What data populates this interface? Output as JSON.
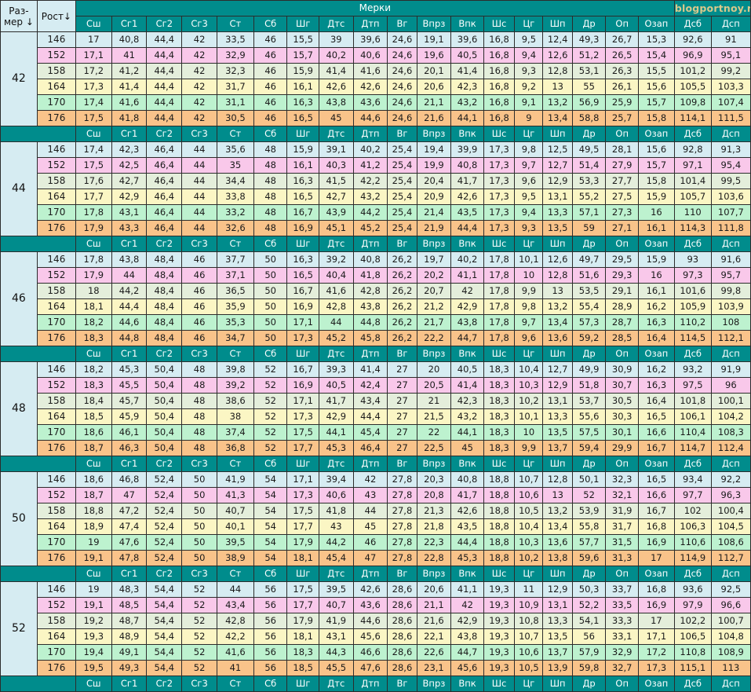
{
  "page": {
    "brand": "blogportnoy.ru",
    "group_header": "Мерки"
  },
  "headers": {
    "size_label_line1": "Раз-",
    "size_label_line2": "мер ↓",
    "growth_label": "Рост↓",
    "measures": [
      "Сш",
      "Сг1",
      "Сг2",
      "Сг3",
      "Ст",
      "Сб",
      "Шг",
      "Дтс",
      "Дтп",
      "Вг",
      "Впрз",
      "Впк",
      "Шс",
      "Цг",
      "Шп",
      "Др",
      "Оп",
      "Озап",
      "Дсб",
      "Дсп"
    ]
  },
  "blocks": [
    {
      "size": "42",
      "rows": [
        {
          "growth": "146",
          "values": [
            "17",
            "40,8",
            "44,4",
            "42",
            "33,5",
            "46",
            "15,5",
            "39",
            "39,6",
            "24,6",
            "19,1",
            "39,6",
            "16,8",
            "9,5",
            "12,4",
            "49,3",
            "26,7",
            "15,3",
            "92,6",
            "91"
          ]
        },
        {
          "growth": "152",
          "values": [
            "17,1",
            "41",
            "44,4",
            "42",
            "32,9",
            "46",
            "15,7",
            "40,2",
            "40,6",
            "24,6",
            "19,6",
            "40,5",
            "16,8",
            "9,4",
            "12,6",
            "51,2",
            "26,5",
            "15,4",
            "96,9",
            "95,1"
          ]
        },
        {
          "growth": "158",
          "values": [
            "17,2",
            "41,2",
            "44,4",
            "42",
            "32,3",
            "46",
            "15,9",
            "41,4",
            "41,6",
            "24,6",
            "20,1",
            "41,4",
            "16,8",
            "9,3",
            "12,8",
            "53,1",
            "26,3",
            "15,5",
            "101,2",
            "99,2"
          ]
        },
        {
          "growth": "164",
          "values": [
            "17,3",
            "41,4",
            "44,4",
            "42",
            "31,7",
            "46",
            "16,1",
            "42,6",
            "42,6",
            "24,6",
            "20,6",
            "42,3",
            "16,8",
            "9,2",
            "13",
            "55",
            "26,1",
            "15,6",
            "105,5",
            "103,3"
          ]
        },
        {
          "growth": "170",
          "values": [
            "17,4",
            "41,6",
            "44,4",
            "42",
            "31,1",
            "46",
            "16,3",
            "43,8",
            "43,6",
            "24,6",
            "21,1",
            "43,2",
            "16,8",
            "9,1",
            "13,2",
            "56,9",
            "25,9",
            "15,7",
            "109,8",
            "107,4"
          ]
        },
        {
          "growth": "176",
          "values": [
            "17,5",
            "41,8",
            "44,4",
            "42",
            "30,5",
            "46",
            "16,5",
            "45",
            "44,6",
            "24,6",
            "21,6",
            "44,1",
            "16,8",
            "9",
            "13,4",
            "58,8",
            "25,7",
            "15,8",
            "114,1",
            "111,5"
          ]
        }
      ]
    },
    {
      "size": "44",
      "rows": [
        {
          "growth": "146",
          "values": [
            "17,4",
            "42,3",
            "46,4",
            "44",
            "35,6",
            "48",
            "15,9",
            "39,1",
            "40,2",
            "25,4",
            "19,4",
            "39,9",
            "17,3",
            "9,8",
            "12,5",
            "49,5",
            "28,1",
            "15,6",
            "92,8",
            "91,3"
          ]
        },
        {
          "growth": "152",
          "values": [
            "17,5",
            "42,5",
            "46,4",
            "44",
            "35",
            "48",
            "16,1",
            "40,3",
            "41,2",
            "25,4",
            "19,9",
            "40,8",
            "17,3",
            "9,7",
            "12,7",
            "51,4",
            "27,9",
            "15,7",
            "97,1",
            "95,4"
          ]
        },
        {
          "growth": "158",
          "values": [
            "17,6",
            "42,7",
            "46,4",
            "44",
            "34,4",
            "48",
            "16,3",
            "41,5",
            "42,2",
            "25,4",
            "20,4",
            "41,7",
            "17,3",
            "9,6",
            "12,9",
            "53,3",
            "27,7",
            "15,8",
            "101,4",
            "99,5"
          ]
        },
        {
          "growth": "164",
          "values": [
            "17,7",
            "42,9",
            "46,4",
            "44",
            "33,8",
            "48",
            "16,5",
            "42,7",
            "43,2",
            "25,4",
            "20,9",
            "42,6",
            "17,3",
            "9,5",
            "13,1",
            "55,2",
            "27,5",
            "15,9",
            "105,7",
            "103,6"
          ]
        },
        {
          "growth": "170",
          "values": [
            "17,8",
            "43,1",
            "46,4",
            "44",
            "33,2",
            "48",
            "16,7",
            "43,9",
            "44,2",
            "25,4",
            "21,4",
            "43,5",
            "17,3",
            "9,4",
            "13,3",
            "57,1",
            "27,3",
            "16",
            "110",
            "107,7"
          ]
        },
        {
          "growth": "176",
          "values": [
            "17,9",
            "43,3",
            "46,4",
            "44",
            "32,6",
            "48",
            "16,9",
            "45,1",
            "45,2",
            "25,4",
            "21,9",
            "44,4",
            "17,3",
            "9,3",
            "13,5",
            "59",
            "27,1",
            "16,1",
            "114,3",
            "111,8"
          ]
        }
      ]
    },
    {
      "size": "46",
      "rows": [
        {
          "growth": "146",
          "values": [
            "17,8",
            "43,8",
            "48,4",
            "46",
            "37,7",
            "50",
            "16,3",
            "39,2",
            "40,8",
            "26,2",
            "19,7",
            "40,2",
            "17,8",
            "10,1",
            "12,6",
            "49,7",
            "29,5",
            "15,9",
            "93",
            "91,6"
          ]
        },
        {
          "growth": "152",
          "values": [
            "17,9",
            "44",
            "48,4",
            "46",
            "37,1",
            "50",
            "16,5",
            "40,4",
            "41,8",
            "26,2",
            "20,2",
            "41,1",
            "17,8",
            "10",
            "12,8",
            "51,6",
            "29,3",
            "16",
            "97,3",
            "95,7"
          ]
        },
        {
          "growth": "158",
          "values": [
            "18",
            "44,2",
            "48,4",
            "46",
            "36,5",
            "50",
            "16,7",
            "41,6",
            "42,8",
            "26,2",
            "20,7",
            "42",
            "17,8",
            "9,9",
            "13",
            "53,5",
            "29,1",
            "16,1",
            "101,6",
            "99,8"
          ]
        },
        {
          "growth": "164",
          "values": [
            "18,1",
            "44,4",
            "48,4",
            "46",
            "35,9",
            "50",
            "16,9",
            "42,8",
            "43,8",
            "26,2",
            "21,2",
            "42,9",
            "17,8",
            "9,8",
            "13,2",
            "55,4",
            "28,9",
            "16,2",
            "105,9",
            "103,9"
          ]
        },
        {
          "growth": "170",
          "values": [
            "18,2",
            "44,6",
            "48,4",
            "46",
            "35,3",
            "50",
            "17,1",
            "44",
            "44,8",
            "26,2",
            "21,7",
            "43,8",
            "17,8",
            "9,7",
            "13,4",
            "57,3",
            "28,7",
            "16,3",
            "110,2",
            "108"
          ]
        },
        {
          "growth": "176",
          "values": [
            "18,3",
            "44,8",
            "48,4",
            "46",
            "34,7",
            "50",
            "17,3",
            "45,2",
            "45,8",
            "26,2",
            "22,2",
            "44,7",
            "17,8",
            "9,6",
            "13,6",
            "59,2",
            "28,5",
            "16,4",
            "114,5",
            "112,1"
          ]
        }
      ]
    },
    {
      "size": "48",
      "rows": [
        {
          "growth": "146",
          "values": [
            "18,2",
            "45,3",
            "50,4",
            "48",
            "39,8",
            "52",
            "16,7",
            "39,3",
            "41,4",
            "27",
            "20",
            "40,5",
            "18,3",
            "10,4",
            "12,7",
            "49,9",
            "30,9",
            "16,2",
            "93,2",
            "91,9"
          ]
        },
        {
          "growth": "152",
          "values": [
            "18,3",
            "45,5",
            "50,4",
            "48",
            "39,2",
            "52",
            "16,9",
            "40,5",
            "42,4",
            "27",
            "20,5",
            "41,4",
            "18,3",
            "10,3",
            "12,9",
            "51,8",
            "30,7",
            "16,3",
            "97,5",
            "96"
          ]
        },
        {
          "growth": "158",
          "values": [
            "18,4",
            "45,7",
            "50,4",
            "48",
            "38,6",
            "52",
            "17,1",
            "41,7",
            "43,4",
            "27",
            "21",
            "42,3",
            "18,3",
            "10,2",
            "13,1",
            "53,7",
            "30,5",
            "16,4",
            "101,8",
            "100,1"
          ]
        },
        {
          "growth": "164",
          "values": [
            "18,5",
            "45,9",
            "50,4",
            "48",
            "38",
            "52",
            "17,3",
            "42,9",
            "44,4",
            "27",
            "21,5",
            "43,2",
            "18,3",
            "10,1",
            "13,3",
            "55,6",
            "30,3",
            "16,5",
            "106,1",
            "104,2"
          ]
        },
        {
          "growth": "170",
          "values": [
            "18,6",
            "46,1",
            "50,4",
            "48",
            "37,4",
            "52",
            "17,5",
            "44,1",
            "45,4",
            "27",
            "22",
            "44,1",
            "18,3",
            "10",
            "13,5",
            "57,5",
            "30,1",
            "16,6",
            "110,4",
            "108,3"
          ]
        },
        {
          "growth": "176",
          "values": [
            "18,7",
            "46,3",
            "50,4",
            "48",
            "36,8",
            "52",
            "17,7",
            "45,3",
            "46,4",
            "27",
            "22,5",
            "45",
            "18,3",
            "9,9",
            "13,7",
            "59,4",
            "29,9",
            "16,7",
            "114,7",
            "112,4"
          ]
        }
      ]
    },
    {
      "size": "50",
      "rows": [
        {
          "growth": "146",
          "values": [
            "18,6",
            "46,8",
            "52,4",
            "50",
            "41,9",
            "54",
            "17,1",
            "39,4",
            "42",
            "27,8",
            "20,3",
            "40,8",
            "18,8",
            "10,7",
            "12,8",
            "50,1",
            "32,3",
            "16,5",
            "93,4",
            "92,2"
          ]
        },
        {
          "growth": "152",
          "values": [
            "18,7",
            "47",
            "52,4",
            "50",
            "41,3",
            "54",
            "17,3",
            "40,6",
            "43",
            "27,8",
            "20,8",
            "41,7",
            "18,8",
            "10,6",
            "13",
            "52",
            "32,1",
            "16,6",
            "97,7",
            "96,3"
          ]
        },
        {
          "growth": "158",
          "values": [
            "18,8",
            "47,2",
            "52,4",
            "50",
            "40,7",
            "54",
            "17,5",
            "41,8",
            "44",
            "27,8",
            "21,3",
            "42,6",
            "18,8",
            "10,5",
            "13,2",
            "53,9",
            "31,9",
            "16,7",
            "102",
            "100,4"
          ]
        },
        {
          "growth": "164",
          "values": [
            "18,9",
            "47,4",
            "52,4",
            "50",
            "40,1",
            "54",
            "17,7",
            "43",
            "45",
            "27,8",
            "21,8",
            "43,5",
            "18,8",
            "10,4",
            "13,4",
            "55,8",
            "31,7",
            "16,8",
            "106,3",
            "104,5"
          ]
        },
        {
          "growth": "170",
          "values": [
            "19",
            "47,6",
            "52,4",
            "50",
            "39,5",
            "54",
            "17,9",
            "44,2",
            "46",
            "27,8",
            "22,3",
            "44,4",
            "18,8",
            "10,3",
            "13,6",
            "57,7",
            "31,5",
            "16,9",
            "110,6",
            "108,6"
          ]
        },
        {
          "growth": "176",
          "values": [
            "19,1",
            "47,8",
            "52,4",
            "50",
            "38,9",
            "54",
            "18,1",
            "45,4",
            "47",
            "27,8",
            "22,8",
            "45,3",
            "18,8",
            "10,2",
            "13,8",
            "59,6",
            "31,3",
            "17",
            "114,9",
            "112,7"
          ]
        }
      ]
    },
    {
      "size": "52",
      "rows": [
        {
          "growth": "146",
          "values": [
            "19",
            "48,3",
            "54,4",
            "52",
            "44",
            "56",
            "17,5",
            "39,5",
            "42,6",
            "28,6",
            "20,6",
            "41,1",
            "19,3",
            "11",
            "12,9",
            "50,3",
            "33,7",
            "16,8",
            "93,6",
            "92,5"
          ]
        },
        {
          "growth": "152",
          "values": [
            "19,1",
            "48,5",
            "54,4",
            "52",
            "43,4",
            "56",
            "17,7",
            "40,7",
            "43,6",
            "28,6",
            "21,1",
            "42",
            "19,3",
            "10,9",
            "13,1",
            "52,2",
            "33,5",
            "16,9",
            "97,9",
            "96,6"
          ]
        },
        {
          "growth": "158",
          "values": [
            "19,2",
            "48,7",
            "54,4",
            "52",
            "42,8",
            "56",
            "17,9",
            "41,9",
            "44,6",
            "28,6",
            "21,6",
            "42,9",
            "19,3",
            "10,8",
            "13,3",
            "54,1",
            "33,3",
            "17",
            "102,2",
            "100,7"
          ]
        },
        {
          "growth": "164",
          "values": [
            "19,3",
            "48,9",
            "54,4",
            "52",
            "42,2",
            "56",
            "18,1",
            "43,1",
            "45,6",
            "28,6",
            "22,1",
            "43,8",
            "19,3",
            "10,7",
            "13,5",
            "56",
            "33,1",
            "17,1",
            "106,5",
            "104,8"
          ]
        },
        {
          "growth": "170",
          "values": [
            "19,4",
            "49,1",
            "54,4",
            "52",
            "41,6",
            "56",
            "18,3",
            "44,3",
            "46,6",
            "28,6",
            "22,6",
            "44,7",
            "19,3",
            "10,6",
            "13,7",
            "57,9",
            "32,9",
            "17,2",
            "110,8",
            "108,9"
          ]
        },
        {
          "growth": "176",
          "values": [
            "19,5",
            "49,3",
            "54,4",
            "52",
            "41",
            "56",
            "18,5",
            "45,5",
            "47,6",
            "28,6",
            "23,1",
            "45,6",
            "19,3",
            "10,5",
            "13,9",
            "59,8",
            "32,7",
            "17,3",
            "115,1",
            "113"
          ]
        }
      ]
    }
  ],
  "colors": {
    "teal": "#008c8c",
    "brand_text": "#d9c88b",
    "row_146": "#d6ecf2",
    "row_152": "#f9c8ea",
    "row_158": "#e4eedb",
    "row_164": "#fbf6c4",
    "row_170": "#bdf2cf",
    "row_176": "#f9c38a"
  }
}
